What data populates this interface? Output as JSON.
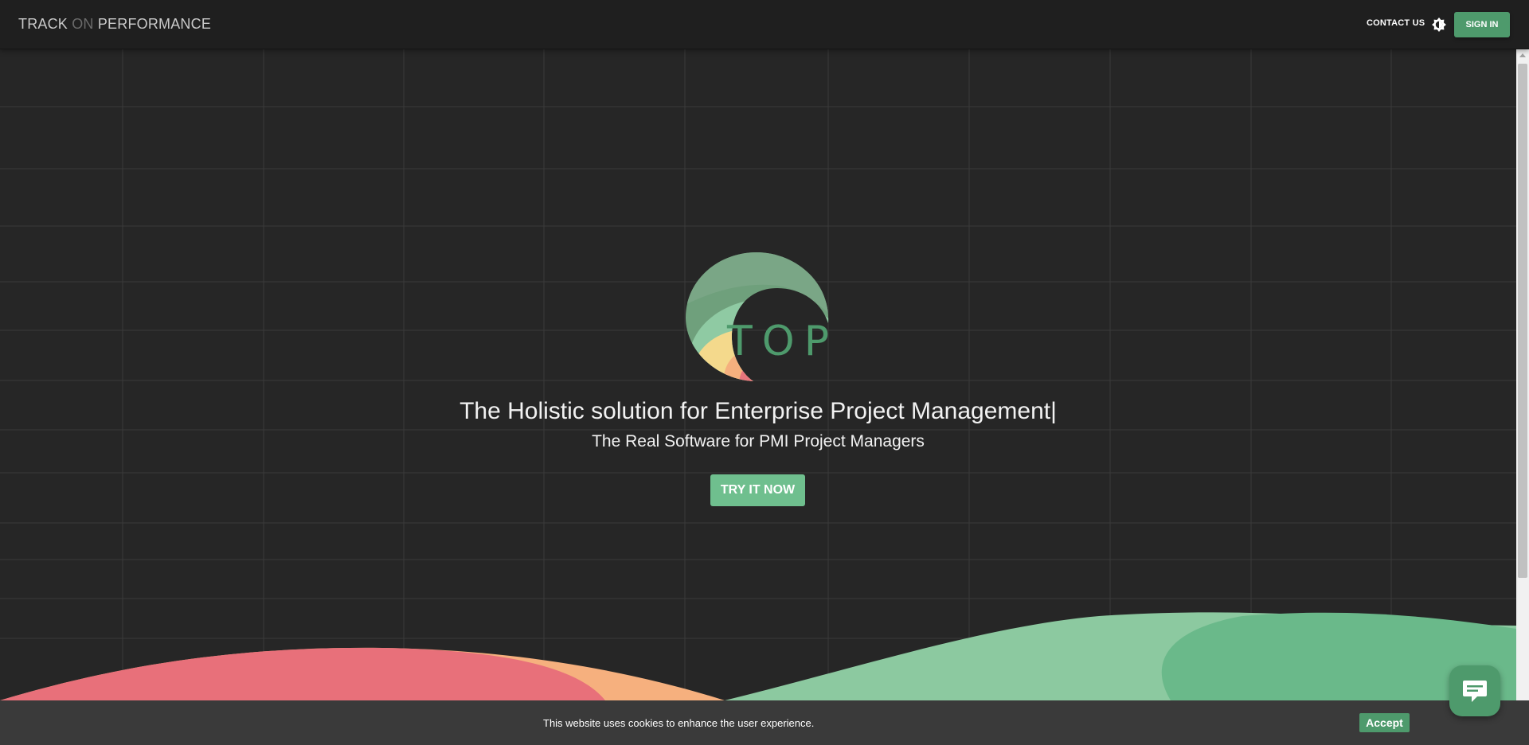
{
  "navbar": {
    "brand_track": "TRACK",
    "brand_on": "ON",
    "brand_performance": "PERFORMANCE",
    "contact_label": "CONTACT US",
    "theme_icon": "brightness-icon",
    "signin_label": "SIGN IN"
  },
  "hero": {
    "logo_text": "TOP",
    "title": "The Holistic solution for Enterprise Project Management|",
    "subtitle": "The Real Software for PMI Project Managers",
    "cta_label": "TRY IT NOW"
  },
  "cookie": {
    "message": "This website uses cookies to enhance the user experience.",
    "accept_label": "Accept"
  },
  "chat": {
    "icon": "chat-icon"
  },
  "colors": {
    "background": "#262626",
    "navbar": "#1f1f1f",
    "accent_green": "#4e9a6c",
    "cta_green": "#6fbf8e",
    "wave_red": "#e8707a",
    "wave_orange": "#f6b07e",
    "wave_green": "#7cc496"
  }
}
